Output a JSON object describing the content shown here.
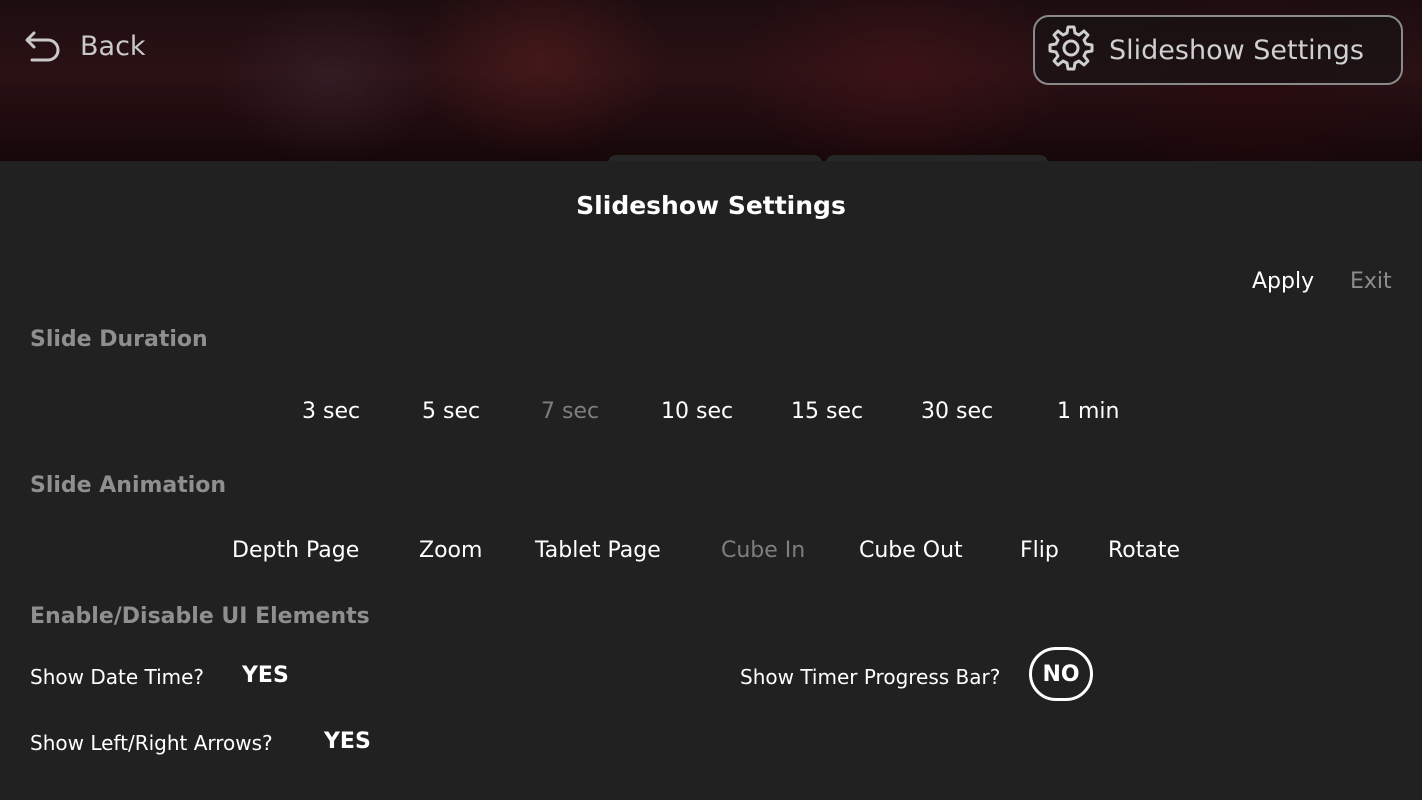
{
  "header": {
    "back_label": "Back",
    "settings_button_label": "Slideshow Settings"
  },
  "panel": {
    "title": "Slideshow Settings",
    "apply_label": "Apply",
    "exit_label": "Exit"
  },
  "slide_duration": {
    "label": "Slide Duration",
    "options": [
      "3 sec",
      "5 sec",
      "7 sec",
      "10 sec",
      "15 sec",
      "30 sec",
      "1 min"
    ],
    "selected": "7 sec"
  },
  "slide_animation": {
    "label": "Slide Animation",
    "options": [
      "Depth Page",
      "Zoom",
      "Tablet Page",
      "Cube In",
      "Cube Out",
      "Flip",
      "Rotate"
    ],
    "selected": "Cube In"
  },
  "ui_elements": {
    "label": "Enable/Disable UI Elements",
    "show_date_time": {
      "label": "Show Date Time?",
      "value": "YES"
    },
    "show_arrows": {
      "label": "Show Left/Right Arrows?",
      "value": "YES"
    },
    "show_timer_bar": {
      "label": "Show Timer Progress Bar?",
      "value": "NO"
    }
  },
  "icons": {
    "back": "back-arrow-icon",
    "settings": "gear-icon"
  },
  "colors": {
    "panel_background": "#212121",
    "text_primary": "#ffffff",
    "text_muted": "#8f8f8f",
    "selected_option": "#7e7e7e"
  }
}
